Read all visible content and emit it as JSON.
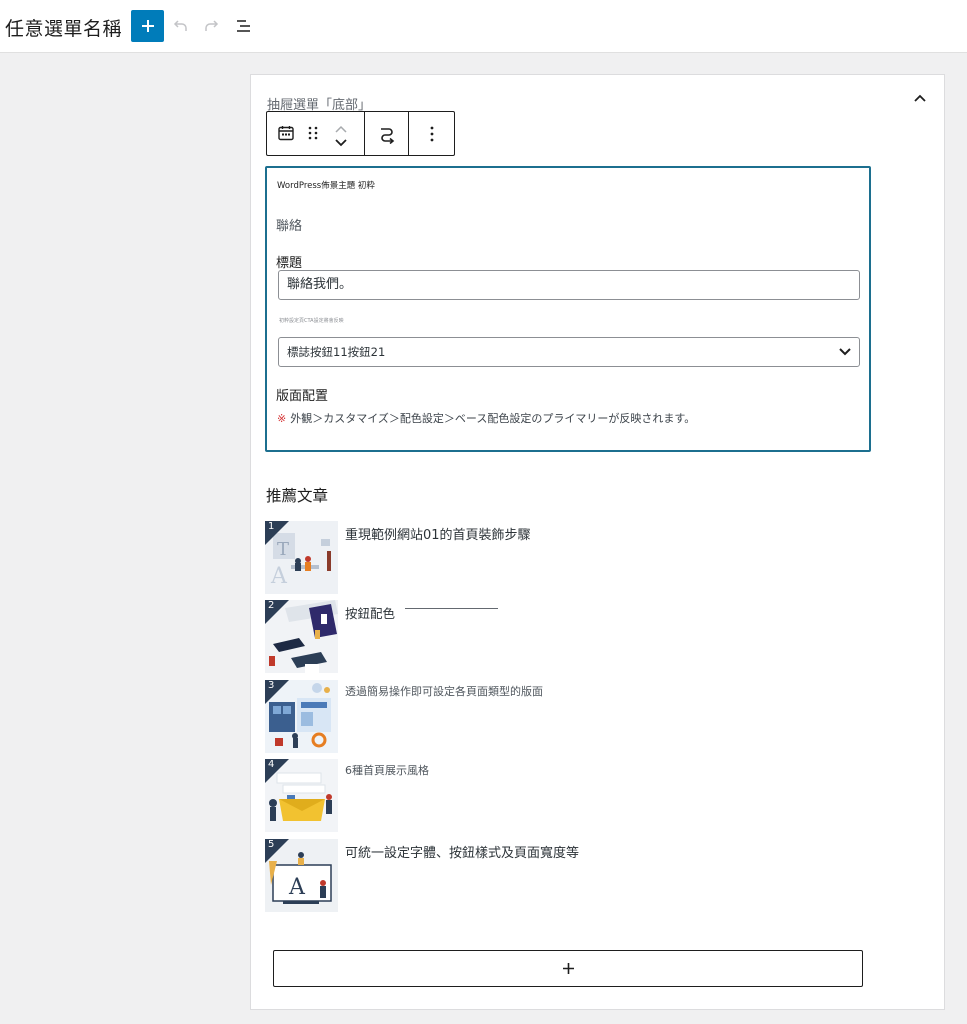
{
  "header": {
    "title": "任意選單名稱",
    "add_icon": "plus-icon",
    "undo_icon": "undo-icon",
    "redo_icon": "redo-icon",
    "outline_icon": "list-view-icon"
  },
  "panel": {
    "drawer_label": "抽屜選單「底部」",
    "collapse_icon": "chevron-up-icon"
  },
  "block_toolbar": {
    "icons": [
      "calendar-icon",
      "drag-handle-icon",
      "move-up-icon",
      "move-down-icon",
      "transform-icon",
      "more-options-icon"
    ]
  },
  "widget": {
    "site_name": "WordPress佈景主題 初粋",
    "contact_label": "聯絡",
    "title_label": "標題",
    "title_value": "聯絡我們。",
    "tiny_note": "初粋設定頁CTA設定將會反映",
    "select_value": "標誌按鈕11按鈕21",
    "layout_label": "版面配置",
    "note_mark": "※",
    "note_text": "外観＞カスタマイズ＞配色設定＞ベース配色設定のプライマリーが反映されます。"
  },
  "recommended": {
    "heading": "推薦文章",
    "posts": [
      {
        "rank": "1",
        "title": "重現範例網站01的首頁裝飾步驟"
      },
      {
        "rank": "2",
        "title": "按鈕配色"
      },
      {
        "rank": "3",
        "title": "透過簡易操作即可設定各頁面類型的版面"
      },
      {
        "rank": "4",
        "title": "6種首頁展示風格"
      },
      {
        "rank": "5",
        "title": "可統一設定字體、按鈕樣式及頁面寬度等"
      }
    ]
  },
  "appender": {
    "icon": "plus-icon"
  },
  "colors": {
    "accent": "#007cba",
    "selection_border": "#1c6f8f",
    "rank_badge": "#2c3e56",
    "note_mark": "#d63638"
  }
}
